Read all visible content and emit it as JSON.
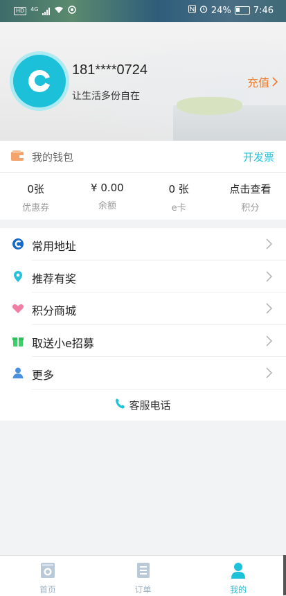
{
  "status_bar": {
    "hd": "HD",
    "network": "4G",
    "battery_percent": "24%",
    "time": "7:46"
  },
  "profile": {
    "phone": "181****0724",
    "slogan": "让生活多份自在",
    "recharge_label": "充值"
  },
  "wallet": {
    "title": "我的钱包",
    "invoice_label": "开发票",
    "stats": [
      {
        "value": "0张",
        "label": "优惠券"
      },
      {
        "value": "¥ 0.00",
        "label": "余额"
      },
      {
        "value": "0 张",
        "label": "e卡"
      },
      {
        "value": "点击查看",
        "label": "积分"
      }
    ]
  },
  "menu": {
    "items": [
      {
        "label": "常用地址",
        "icon": "address-icon"
      },
      {
        "label": "推荐有奖",
        "icon": "location-pin-icon"
      },
      {
        "label": "积分商城",
        "icon": "heart-icon"
      },
      {
        "label": "取送小e招募",
        "icon": "gift-icon"
      },
      {
        "label": "更多",
        "icon": "user-icon"
      }
    ],
    "service_label": "客服电话"
  },
  "tabbar": {
    "tabs": [
      {
        "label": "首页",
        "icon": "washer-icon"
      },
      {
        "label": "订单",
        "icon": "list-icon"
      },
      {
        "label": "我的",
        "icon": "person-icon"
      }
    ],
    "active_tab": "我的"
  },
  "colors": {
    "accent": "#1ec2d8",
    "recharge": "#f07a27",
    "wallet_icon": "#f4a36a"
  }
}
